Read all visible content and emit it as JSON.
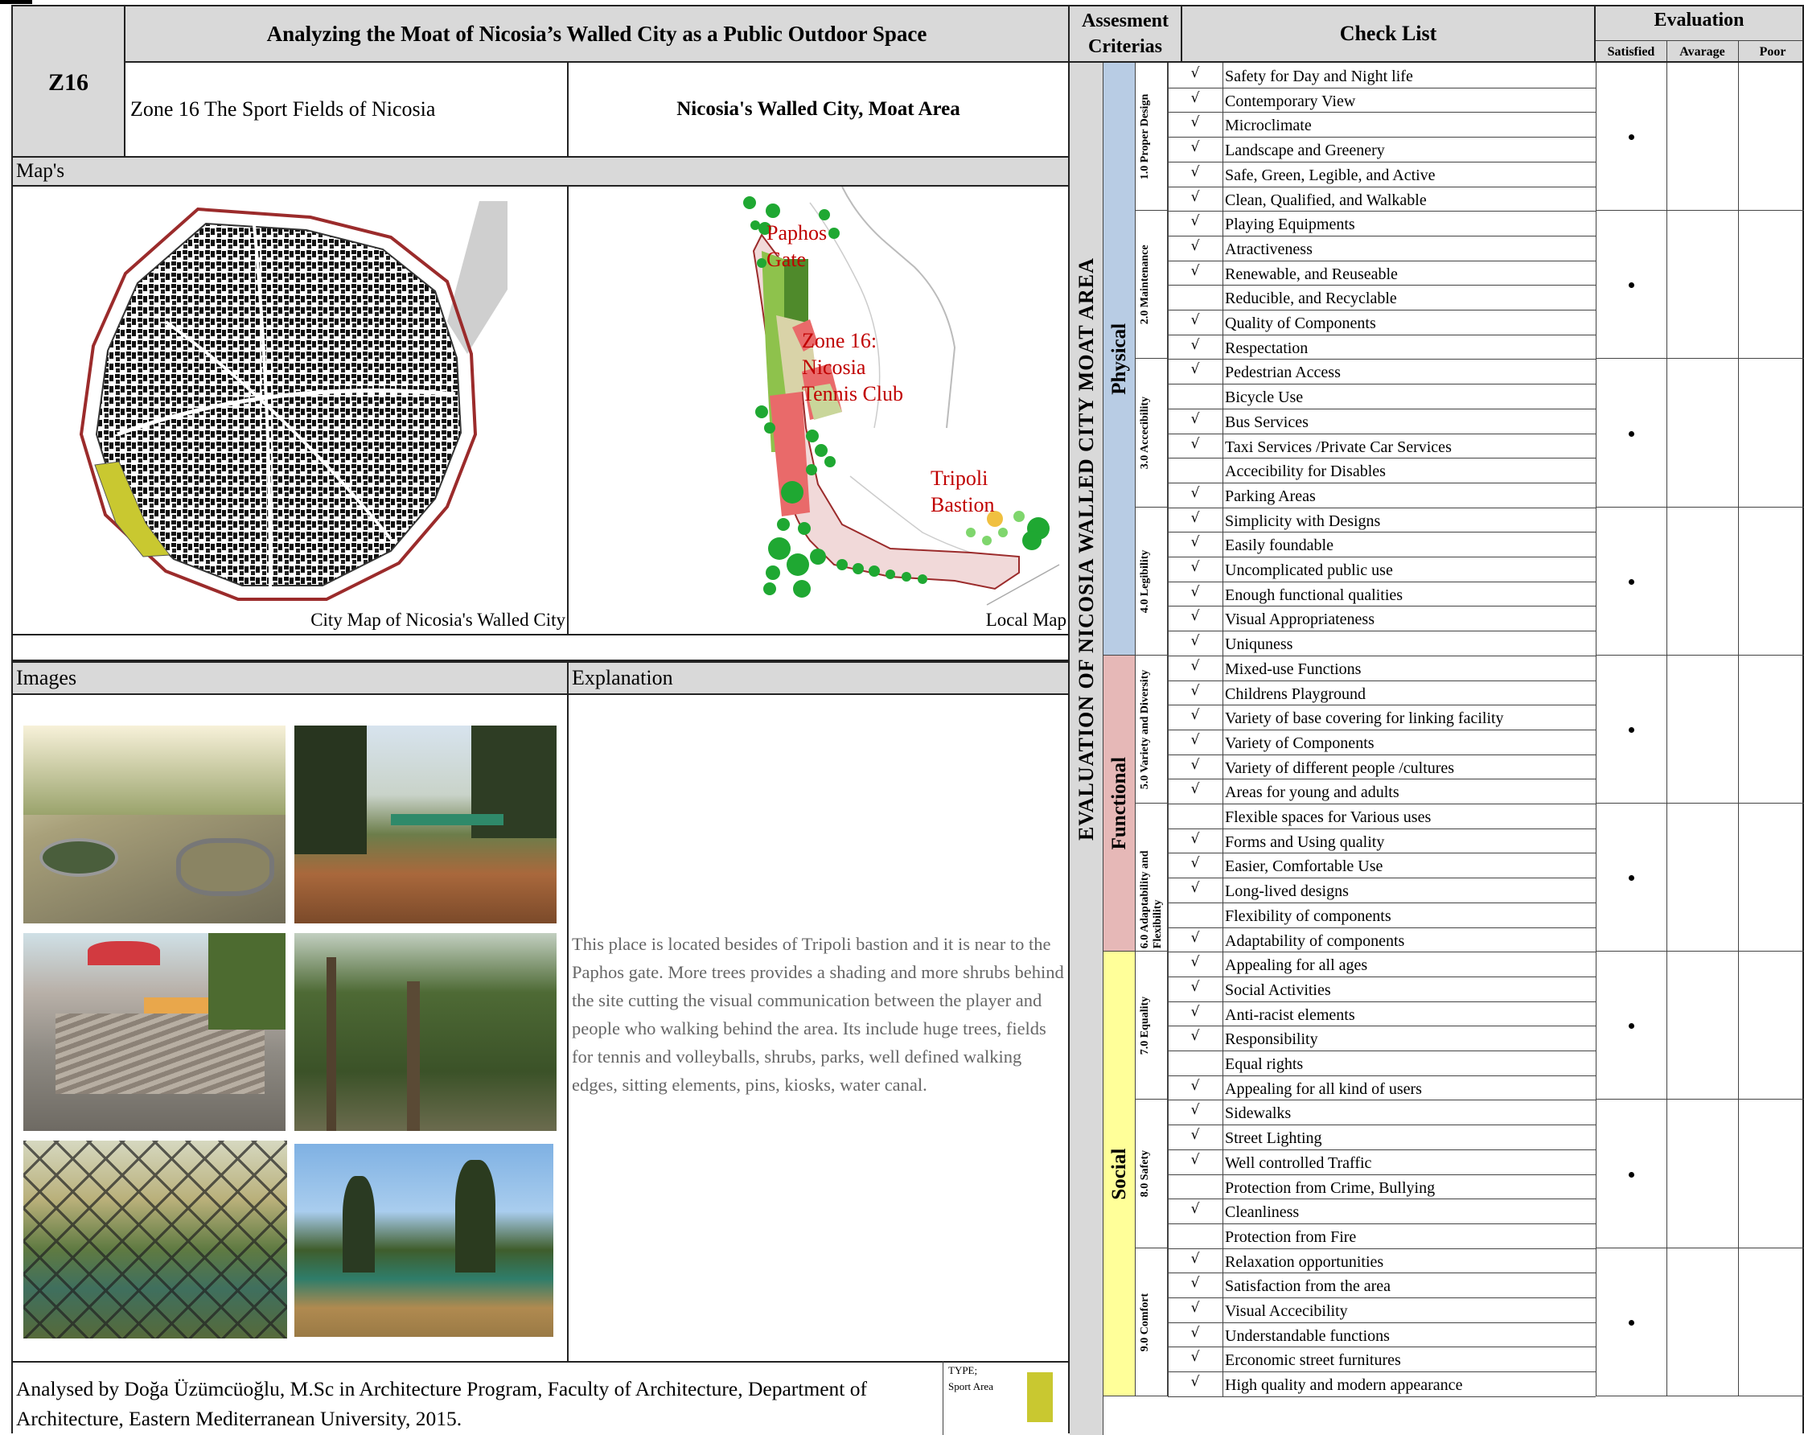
{
  "header": {
    "title": "Analyzing the Moat of Nicosia’s Walled City as a Public Outdoor Space",
    "assessment_heading": "Assesment Criterias",
    "checklist_heading": "Check List",
    "evaluation_heading": "Evaluation",
    "eval_columns": [
      "Satisfied",
      "Avarage",
      "Poor"
    ]
  },
  "zone": {
    "code": "Z16",
    "name": "Zone 16 The Sport Fields of Nicosia",
    "area": "Nicosia's Walled City, Moat Area"
  },
  "maps": {
    "section_label": "Map's",
    "city_caption": "City Map of Nicosia's Walled City",
    "local_caption": "Local Map",
    "local_labels": [
      "Paphos",
      "Gate",
      "Zone 16:",
      "Nicosia",
      "Tennis Club",
      "Tripoli",
      "Bastion"
    ]
  },
  "images_label": "Images",
  "explanation": {
    "label": "Explanation",
    "text": "This place is located besides of Tripoli bastion and it is near to the Paphos gate. More trees provides a shading and more shrubs behind the site cutting the visual communication between the player and people who walking behind the area. Its include huge trees, fields for tennis and volleyballs, shrubs, parks, well defined walking edges, sitting elements, pins, kiosks, water canal."
  },
  "footer": {
    "credit": "Analysed by Doğa Üzümcüoğlu, M.Sc in Architecture Program, Faculty of Architecture, Department of Architecture, Eastern Mediterranean University, 2015.",
    "type_label": "TYPE; Sport Area",
    "type_color": "#c9c830"
  },
  "vertical_title": "EVALUATION OF NICOSIA WALLED CITY MOAT AREA",
  "check_mark": "√",
  "dot_mark": "•",
  "categories": [
    {
      "name": "Physical",
      "color": "#b8cce4"
    },
    {
      "name": "Functional",
      "color": "#e6b8b7"
    },
    {
      "name": "Social",
      "color": "#ffff99"
    }
  ],
  "criteria": [
    {
      "label": "1.0 Proper Design",
      "evaluation": "Satisfied",
      "items": [
        {
          "text": "Safety for Day and Night life",
          "check": true
        },
        {
          "text": "Contemporary View",
          "check": true
        },
        {
          "text": "Microclimate",
          "check": true
        },
        {
          "text": "Landscape and Greenery",
          "check": true
        },
        {
          "text": "Safe, Green, Legible, and Active",
          "check": true
        },
        {
          "text": "Clean, Qualified, and Walkable",
          "check": true
        }
      ]
    },
    {
      "label": "2.0 Maintenance",
      "evaluation": "Satisfied",
      "items": [
        {
          "text": "Playing Equipments",
          "check": true
        },
        {
          "text": "Atractiveness",
          "check": true
        },
        {
          "text": "Renewable, and Reuseable",
          "check": true
        },
        {
          "text": "Reducible, and Recyclable",
          "check": false
        },
        {
          "text": "Quality of Components",
          "check": true
        },
        {
          "text": "Respectation",
          "check": true
        }
      ]
    },
    {
      "label": "3.0 Accecibility",
      "evaluation": "Satisfied",
      "items": [
        {
          "text": "Pedestrian Access",
          "check": true
        },
        {
          "text": "Bicycle Use",
          "check": false
        },
        {
          "text": "Bus Services",
          "check": true
        },
        {
          "text": "Taxi Services /Private Car Services",
          "check": true
        },
        {
          "text": "Accecibility for Disables",
          "check": false
        },
        {
          "text": "Parking Areas",
          "check": true
        }
      ]
    },
    {
      "label": "4.0 Legibility",
      "evaluation": "Satisfied",
      "items": [
        {
          "text": "Simplicity with Designs",
          "check": true
        },
        {
          "text": "Easily foundable",
          "check": true
        },
        {
          "text": "Uncomplicated public use",
          "check": true
        },
        {
          "text": "Enough functional qualities",
          "check": true
        },
        {
          "text": "Visual Appropriateness",
          "check": true
        },
        {
          "text": "Uniquness",
          "check": true
        }
      ]
    },
    {
      "label": "5.0 Variety and Diversity",
      "evaluation": "Satisfied",
      "items": [
        {
          "text": "Mixed-use Functions",
          "check": true
        },
        {
          "text": "Childrens Playground",
          "check": true
        },
        {
          "text": "Variety of base covering for linking facility",
          "check": true
        },
        {
          "text": "Variety of Components",
          "check": true
        },
        {
          "text": "Variety of different people /cultures",
          "check": true
        },
        {
          "text": "Areas for young and adults",
          "check": true
        }
      ]
    },
    {
      "label": "6.0 Adaptability and Flexibility",
      "evaluation": "Satisfied",
      "items": [
        {
          "text": "Flexible spaces for Various uses",
          "check": false
        },
        {
          "text": "Forms and Using quality",
          "check": true
        },
        {
          "text": "Easier, Comfortable Use",
          "check": true
        },
        {
          "text": "Long-lived designs",
          "check": true
        },
        {
          "text": "Flexibility of components",
          "check": false
        },
        {
          "text": "Adaptability of components",
          "check": true
        }
      ]
    },
    {
      "label": "7.0 Equality",
      "evaluation": "Satisfied",
      "items": [
        {
          "text": "Appealing for all ages",
          "check": true
        },
        {
          "text": "Social Activities",
          "check": true
        },
        {
          "text": "Anti-racist elements",
          "check": true
        },
        {
          "text": "Responsibility",
          "check": true
        },
        {
          "text": "Equal rights",
          "check": false
        },
        {
          "text": "Appealing for all kind of users",
          "check": true
        }
      ]
    },
    {
      "label": "8.0 Safety",
      "evaluation": "Satisfied",
      "items": [
        {
          "text": "Sidewalks",
          "check": true
        },
        {
          "text": "Street Lighting",
          "check": true
        },
        {
          "text": "Well controlled Traffic",
          "check": true
        },
        {
          "text": "Protection from Crime, Bullying",
          "check": false
        },
        {
          "text": "Cleanliness",
          "check": true
        },
        {
          "text": "Protection from Fire",
          "check": false
        }
      ]
    },
    {
      "label": "9.0 Comfort",
      "evaluation": "Satisfied",
      "items": [
        {
          "text": "Relaxation opportunities",
          "check": true
        },
        {
          "text": "Satisfaction from the area",
          "check": true
        },
        {
          "text": "Visual Accecibility",
          "check": true
        },
        {
          "text": "Understandable functions",
          "check": true
        },
        {
          "text": "Erconomic street furnitures",
          "check": true
        },
        {
          "text": "High quality and modern appearance",
          "check": true
        }
      ]
    }
  ]
}
